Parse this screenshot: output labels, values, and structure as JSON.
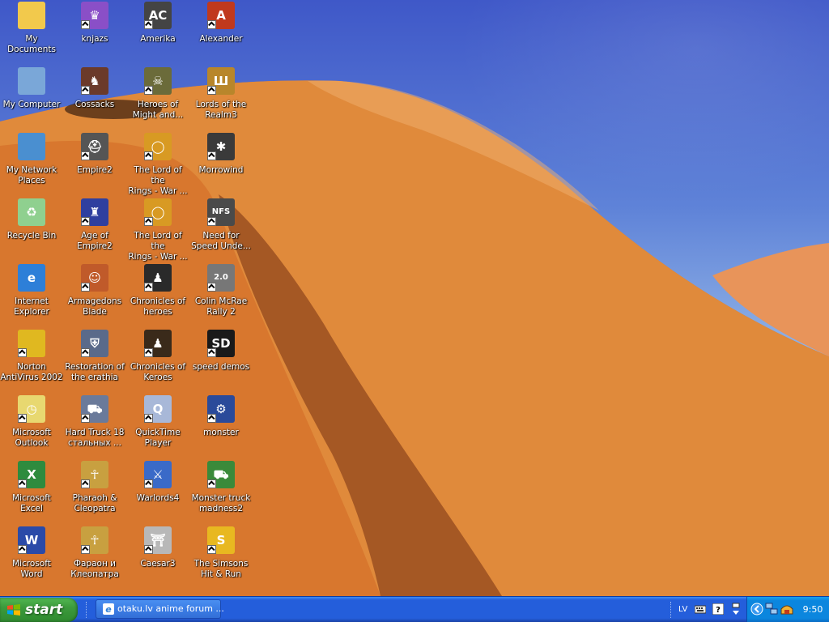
{
  "desktop": {
    "icons": [
      {
        "label": "My Documents",
        "icon": "my-documents-icon",
        "color": "#f2c94c",
        "glyph": "",
        "shortcut": false
      },
      {
        "label": "knjazs",
        "icon": "knjazs-icon",
        "color": "#8a4fc7",
        "glyph": "♛",
        "shortcut": true
      },
      {
        "label": "Amerika",
        "icon": "amerika-icon",
        "color": "#444444",
        "glyph": "AC",
        "shortcut": true
      },
      {
        "label": "Alexander",
        "icon": "alexander-icon",
        "color": "#c0391d",
        "glyph": "A",
        "shortcut": true
      },
      {
        "label": "My Computer",
        "icon": "my-computer-icon",
        "color": "#7aa7d8",
        "glyph": "",
        "shortcut": false
      },
      {
        "label": "Cossacks",
        "icon": "cossacks-icon",
        "color": "#6b3a2a",
        "glyph": "♞",
        "shortcut": true
      },
      {
        "label": "Heroes of\nMight and...",
        "icon": "heroes-icon",
        "color": "#6b6b3a",
        "glyph": "☠",
        "shortcut": true
      },
      {
        "label": "Lords of the\nRealm3",
        "icon": "lords-of-realm-icon",
        "color": "#b8862b",
        "glyph": "Ш",
        "shortcut": true
      },
      {
        "label": "My Network\nPlaces",
        "icon": "network-places-icon",
        "color": "#4a8fd0",
        "glyph": "",
        "shortcut": false
      },
      {
        "label": "Empire2",
        "icon": "empire2-icon",
        "color": "#555555",
        "glyph": "⛑",
        "shortcut": true
      },
      {
        "label": "The Lord of the\nRings - War ...",
        "icon": "lotr-ring-icon",
        "color": "#d89a23",
        "glyph": "◯",
        "shortcut": true
      },
      {
        "label": "Morrowind",
        "icon": "morrowind-icon",
        "color": "#3a3a3a",
        "glyph": "✱",
        "shortcut": true
      },
      {
        "label": "Recycle Bin",
        "icon": "recycle-bin-icon",
        "color": "#8fd08f",
        "glyph": "♻",
        "shortcut": false
      },
      {
        "label": "Age of Empire2",
        "icon": "age-of-empire-icon",
        "color": "#2f3f9f",
        "glyph": "♜",
        "shortcut": true
      },
      {
        "label": "The Lord of the\nRings - War ...",
        "icon": "lotr-ring-icon",
        "color": "#d89a23",
        "glyph": "◯",
        "shortcut": true
      },
      {
        "label": "Need for\nSpeed Unde...",
        "icon": "need-for-speed-icon",
        "color": "#4a4a4a",
        "glyph": "NFS",
        "shortcut": true
      },
      {
        "label": "Internet\nExplorer",
        "icon": "internet-explorer-icon",
        "color": "#2d7fd8",
        "glyph": "e",
        "shortcut": false
      },
      {
        "label": "Armagedons\nBlade",
        "icon": "armagedons-blade-icon",
        "color": "#c05a2a",
        "glyph": "☺",
        "shortcut": true
      },
      {
        "label": "Chronicles of\nheroes",
        "icon": "chronicles-heroes-icon",
        "color": "#2a2a2a",
        "glyph": "♟",
        "shortcut": true
      },
      {
        "label": "Colin McRae\nRally 2",
        "icon": "colin-mcrae-icon",
        "color": "#777777",
        "glyph": "2.0",
        "shortcut": true
      },
      {
        "label": "Norton\nAntiVirus 2002",
        "icon": "norton-antivirus-icon",
        "color": "#e0b820",
        "glyph": "",
        "shortcut": true
      },
      {
        "label": "Restoration of\nthe erathia",
        "icon": "restoration-erathia-icon",
        "color": "#5a6a8a",
        "glyph": "⛨",
        "shortcut": true
      },
      {
        "label": "Chronicles of\nKeroes",
        "icon": "chronicles-keroes-icon",
        "color": "#3a2a1a",
        "glyph": "♟",
        "shortcut": true
      },
      {
        "label": "speed demos",
        "icon": "speed-demos-icon",
        "color": "#1a1a1a",
        "glyph": "SD",
        "shortcut": true
      },
      {
        "label": "Microsoft\nOutlook",
        "icon": "outlook-icon",
        "color": "#e8d870",
        "glyph": "◷",
        "shortcut": true
      },
      {
        "label": "Hard Truck 18\nстальных ...",
        "icon": "hard-truck-icon",
        "color": "#6a7a9a",
        "glyph": "⛟",
        "shortcut": true
      },
      {
        "label": "QuickTime\nPlayer",
        "icon": "quicktime-icon",
        "color": "#a8b8d8",
        "glyph": "Q",
        "shortcut": true
      },
      {
        "label": "monster",
        "icon": "monster-icon",
        "color": "#2a4a9a",
        "glyph": "⚙",
        "shortcut": true
      },
      {
        "label": "Microsoft Excel",
        "icon": "excel-icon",
        "color": "#2e8b3e",
        "glyph": "X",
        "shortcut": true
      },
      {
        "label": "Pharaoh &\nCleopatra",
        "icon": "pharaoh-icon",
        "color": "#c8a040",
        "glyph": "☥",
        "shortcut": true
      },
      {
        "label": "Warlords4",
        "icon": "warlords-icon",
        "color": "#3a6ac8",
        "glyph": "⚔",
        "shortcut": true
      },
      {
        "label": "Monster truck\nmadness2",
        "icon": "monster-truck-icon",
        "color": "#3a8a3a",
        "glyph": "⛟",
        "shortcut": true
      },
      {
        "label": "Microsoft Word",
        "icon": "word-icon",
        "color": "#2a4aa8",
        "glyph": "W",
        "shortcut": true
      },
      {
        "label": "Фараон и\nКлеопатра",
        "icon": "pharaoh-ru-icon",
        "color": "#c8a040",
        "glyph": "☥",
        "shortcut": true
      },
      {
        "label": "Caesar3",
        "icon": "caesar3-icon",
        "color": "#b8b8b8",
        "glyph": "⛩",
        "shortcut": true
      },
      {
        "label": "The Simsons\nHit & Run",
        "icon": "simpsons-icon",
        "color": "#e8b820",
        "glyph": "S",
        "shortcut": true
      }
    ]
  },
  "taskbar": {
    "start_label": "start",
    "task_label": "otaku.lv anime forum ...",
    "language": "LV",
    "clock": "9:50",
    "colors": {
      "start": "#3c9a3c",
      "bar": "#245edb",
      "tray": "#0b86de"
    }
  }
}
